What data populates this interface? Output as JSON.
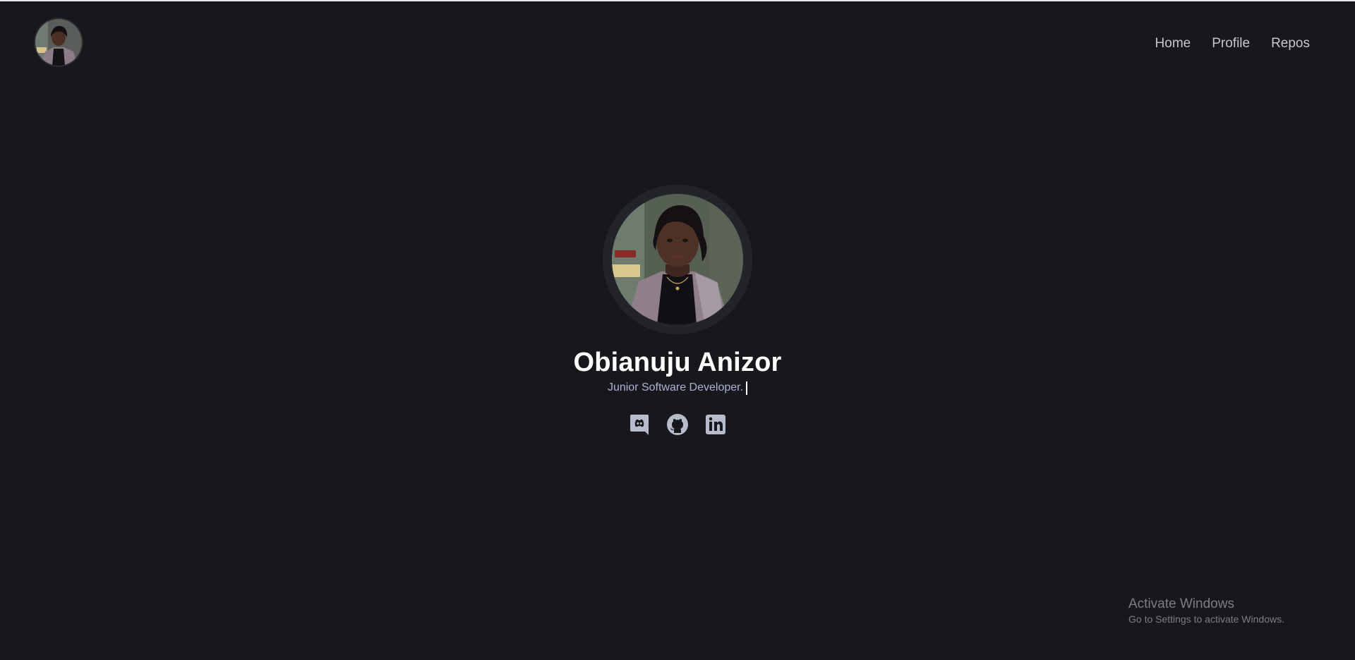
{
  "nav": {
    "items": [
      {
        "label": "Home"
      },
      {
        "label": "Profile"
      },
      {
        "label": "Repos"
      }
    ]
  },
  "profile": {
    "name": "Obianuju Anizor",
    "role": "Junior Software Developer."
  },
  "socials": [
    {
      "icon": "discord-icon"
    },
    {
      "icon": "github-icon"
    },
    {
      "icon": "linkedin-icon"
    }
  ],
  "watermark": {
    "title": "Activate Windows",
    "subtitle": "Go to Settings to activate Windows."
  },
  "colors": {
    "background": "#18171c",
    "nav_text": "#c6c8d0",
    "role_text": "#a9b4d6",
    "icon": "#b7bccb"
  }
}
